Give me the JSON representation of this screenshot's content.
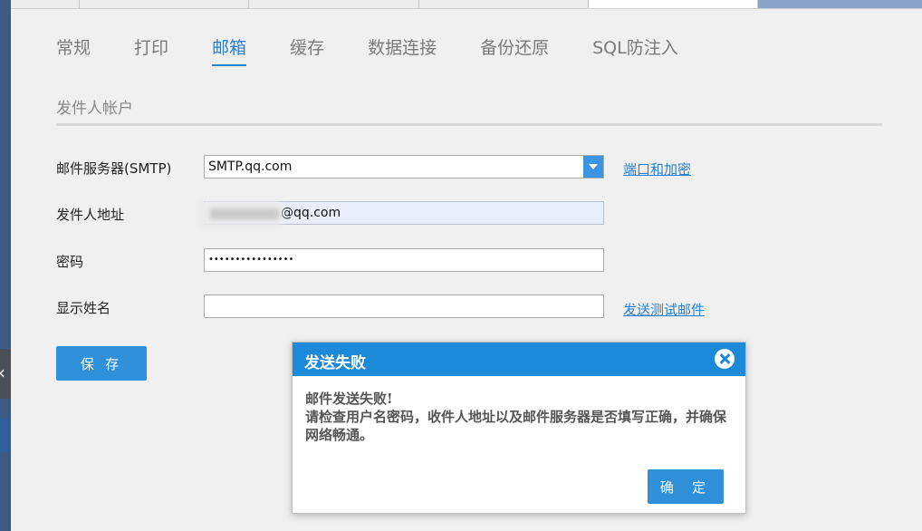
{
  "tabs": [
    {
      "label": "常规"
    },
    {
      "label": "打印"
    },
    {
      "label": "邮箱"
    },
    {
      "label": "缓存"
    },
    {
      "label": "数据连接"
    },
    {
      "label": "备份还原"
    },
    {
      "label": "SQL防注入"
    }
  ],
  "active_tab": "邮箱",
  "section_title": "发件人帐户",
  "form": {
    "smtp_label": "邮件服务器(SMTP)",
    "smtp_value": "SMTP.qq.com",
    "port_link": "端口和加密",
    "sender_label": "发件人地址",
    "sender_value": "@qq.com",
    "password_label": "密码",
    "password_value": "••••••••••••••••",
    "display_name_label": "显示姓名",
    "display_name_value": "",
    "test_link": "发送测试邮件",
    "save_label": "保 存"
  },
  "dialog": {
    "title": "发送失败",
    "line1": "邮件发送失败!",
    "line2": "请检查用户名密码，收件人地址以及邮件服务器是否填写正确，并确保网络畅通。",
    "ok_label": "确 定"
  },
  "colors": {
    "accent": "#2a7fd0",
    "button": "#2f8fd8",
    "dialog_header": "#1c8ad8"
  }
}
